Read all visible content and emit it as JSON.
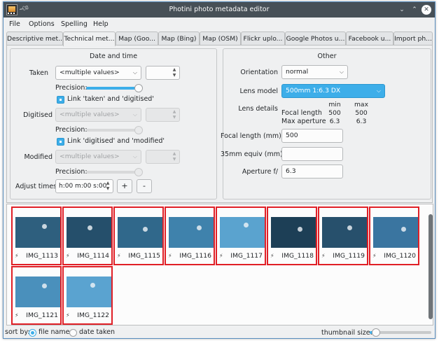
{
  "window": {
    "title": "Photini photo metadata editor"
  },
  "menu": [
    "File",
    "Options",
    "Spelling",
    "Help"
  ],
  "tabs": [
    "Descriptive met...",
    "Technical met...",
    "Map (Goo...",
    "Map (Bing)",
    "Map (OSM)",
    "Flickr uplo...",
    "Google Photos u...",
    "Facebook u...",
    "Import ph..."
  ],
  "active_tab": "Technical met...",
  "date_time": {
    "title": "Date and time",
    "taken_label": "Taken",
    "taken_value": "<multiple values>",
    "precision_label": "Precision:",
    "taken_precision": 1.0,
    "link_taken_digitised": "Link 'taken' and 'digitised'",
    "digitised_label": "Digitised",
    "digitised_value": "<multiple values>",
    "link_digitised_modified": "Link 'digitised' and 'modified'",
    "modified_label": "Modified",
    "modified_value": "<multiple values>",
    "adjust_label": "Adjust times",
    "adjust_value": "h:00 m:00 s:00",
    "plus_label": "+",
    "minus_label": "-"
  },
  "other": {
    "title": "Other",
    "orientation_label": "Orientation",
    "orientation_value": "normal",
    "lens_model_label": "Lens model",
    "lens_model_value": "500mm 1:6.3 DX",
    "lens_details_label": "Lens details",
    "lens_min_header": "min",
    "lens_max_header": "max",
    "focal_length_row_label": "Focal length",
    "focal_min": "500",
    "focal_max": "500",
    "max_aperture_row_label": "Max aperture",
    "aperture_min": "6.3",
    "aperture_max": "6.3",
    "focal_length_mm_label": "Focal length (mm)",
    "focal_length_mm_value": "500",
    "equiv_label": "35mm equiv (mm)",
    "equiv_value": "",
    "aperture_label": "Aperture f/",
    "aperture_value": "6.3"
  },
  "thumbnails": [
    {
      "name": "IMG_1113",
      "color": "#2e5f7e"
    },
    {
      "name": "IMG_1114",
      "color": "#254f6b"
    },
    {
      "name": "IMG_1115",
      "color": "#30688b"
    },
    {
      "name": "IMG_1116",
      "color": "#3f82ac"
    },
    {
      "name": "IMG_1117",
      "color": "#5aa3cf"
    },
    {
      "name": "IMG_1118",
      "color": "#1d3f56"
    },
    {
      "name": "IMG_1119",
      "color": "#27506c"
    },
    {
      "name": "IMG_1120",
      "color": "#3a75a0"
    },
    {
      "name": "IMG_1121",
      "color": "#4a90bc"
    },
    {
      "name": "IMG_1122",
      "color": "#5aa3d0"
    }
  ],
  "thumb_flag_icon": "lightning-icon",
  "bottom": {
    "sort_by_label": "sort by:",
    "sort_file_name": "file name",
    "sort_date_taken": "date taken",
    "sort_selected": "file name",
    "thumbnail_size_label": "thumbnail size:",
    "thumbnail_size_level": 0.1
  },
  "colors": {
    "accent": "#3daee9",
    "titlebar": "#475057",
    "thumb_selection": "#e01f26"
  }
}
